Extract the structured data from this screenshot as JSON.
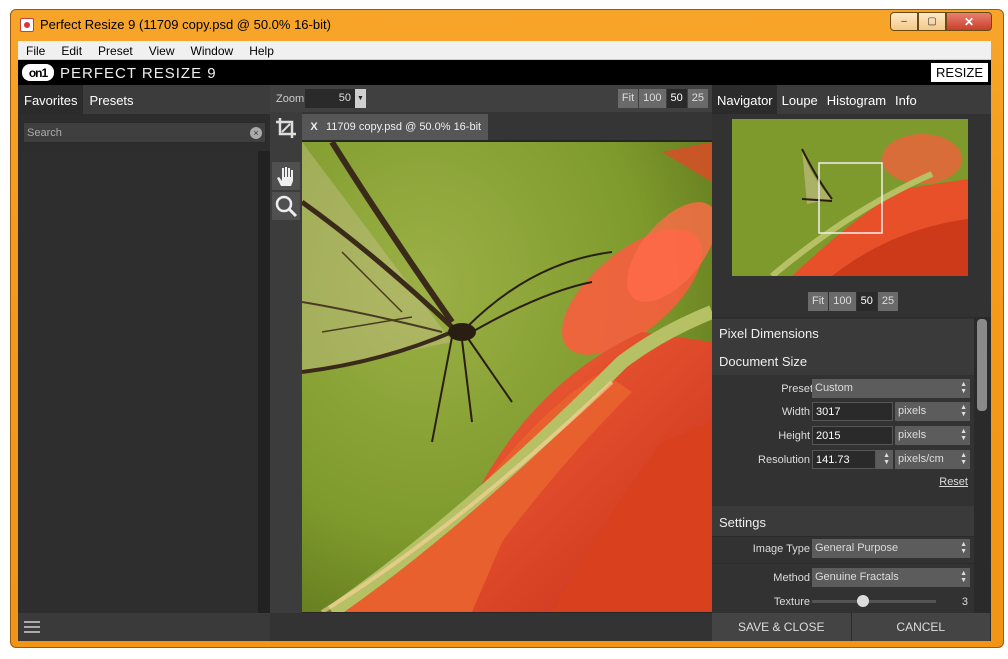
{
  "window": {
    "title": "Perfect Resize 9 (11709 copy.psd @ 50.0% 16-bit)",
    "buttons": [
      "–",
      "▢",
      "✕"
    ]
  },
  "menu": [
    "File",
    "Edit",
    "Preset",
    "View",
    "Window",
    "Help"
  ],
  "brand": {
    "logo": "on1",
    "name": "PERFECT RESIZE 9",
    "resize": "RESIZE"
  },
  "left": {
    "tabs": [
      "Favorites",
      "Presets"
    ],
    "search_placeholder": "Search"
  },
  "zoom": {
    "label": "Zoom",
    "value": "50",
    "buttons": [
      "Fit",
      "100",
      "50",
      "25"
    ],
    "active": "50"
  },
  "document": {
    "close": "X",
    "name": "11709 copy.psd @ 50.0% 16-bit"
  },
  "right": {
    "tabs": [
      "Navigator",
      "Loupe",
      "Histogram",
      "Info"
    ],
    "nav_zoom": [
      "Fit",
      "100",
      "50",
      "25"
    ],
    "pixel_dimensions": "Pixel Dimensions",
    "document_size": "Document Size",
    "preset_label": "Preset",
    "preset_value": "Custom",
    "width_label": "Width",
    "width_value": "3017",
    "width_unit": "pixels",
    "height_label": "Height",
    "height_value": "2015",
    "height_unit": "pixels",
    "resolution_label": "Resolution",
    "resolution_value": "141.73",
    "resolution_unit": "pixels/cm",
    "reset": "Reset",
    "settings": "Settings",
    "image_type_label": "Image Type",
    "image_type_value": "General Purpose",
    "method_label": "Method",
    "method_value": "Genuine Fractals",
    "texture_label": "Texture",
    "texture_value": "3",
    "texture_fraction": 0.4
  },
  "footer": {
    "save": "SAVE & CLOSE",
    "cancel": "CANCEL"
  }
}
